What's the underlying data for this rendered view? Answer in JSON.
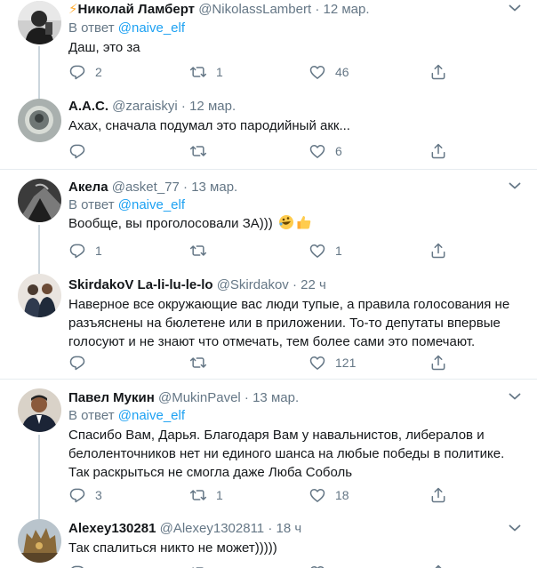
{
  "tweets": [
    {
      "name": "Николай Ламберт",
      "handle": "@NikolassLambert",
      "time": "12 мар.",
      "reply_prefix": "В ответ ",
      "reply_to": "@naive_elf",
      "text": "Даш, это за",
      "replies": "2",
      "retweets": "1",
      "likes": "46"
    },
    {
      "name": "А.А.С.",
      "handle": "@zaraiskyi",
      "time": "12 мар.",
      "text": "Ахах, сначала подумал это пародийный акк...",
      "replies": "",
      "retweets": "",
      "likes": "6"
    },
    {
      "name": "Акела",
      "handle": "@asket_77",
      "time": "13 мар.",
      "reply_prefix": "В ответ ",
      "reply_to": "@naive_elf",
      "text": "Вообще, вы проголосовали ЗА)))",
      "replies": "1",
      "retweets": "",
      "likes": "1"
    },
    {
      "name": "SkirdakoV La-li-lu-le-lo",
      "handle": "@Skirdakov",
      "time": "22 ч",
      "text": "Наверное все окружающие вас люди тупые, а правила голосования не разъяснены на бюлетене или в приложении. То-то депутаты впервые голосуют и не знают что отмечать, тем более сами это помечают.",
      "replies": "",
      "retweets": "",
      "likes": "121"
    },
    {
      "name": "Павел Мукин",
      "handle": "@MukinPavel",
      "time": "13 мар.",
      "reply_prefix": "В ответ ",
      "reply_to": "@naive_elf",
      "text": "Спасибо Вам, Дарья. Благодаря Вам у навальнистов, либералов и белоленточников нет ни единого шанса на любые победы в политике. Так раскрыться не смогла даже Люба Соболь",
      "replies": "3",
      "retweets": "1",
      "likes": "18"
    },
    {
      "name": "Alexey130281",
      "handle": "@Alexey1302811",
      "time": "18 ч",
      "text": "Так спалиться никто не может)))))",
      "replies": "",
      "retweets": "",
      "likes": ""
    }
  ],
  "dot": "·",
  "icons": {
    "reply": "reply-icon",
    "retweet": "retweet-icon",
    "like": "heart-icon",
    "share": "share-icon",
    "more": "chevron-down-icon"
  },
  "colors": {
    "link": "#1da1f2",
    "secondary": "#657786",
    "divider": "#e6ecf0",
    "thread": "#ccd6dd"
  }
}
